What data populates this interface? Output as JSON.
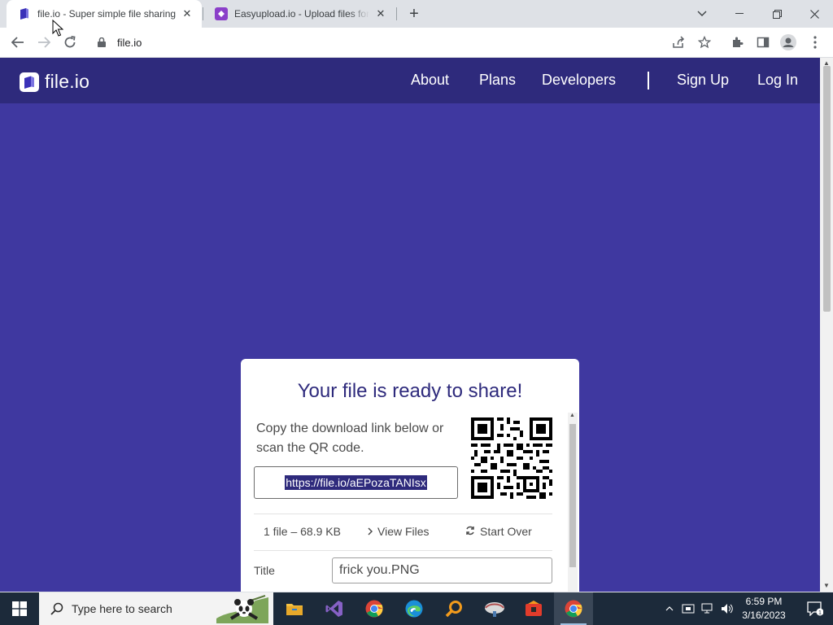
{
  "browser": {
    "tabs": [
      {
        "title": "file.io - Super simple file sharing",
        "favicon": "fileio-favicon",
        "active": true
      },
      {
        "title": "Easyupload.io - Upload files for free",
        "favicon": "easyupload-favicon",
        "active": false
      }
    ],
    "address": "file.io",
    "icons": [
      "back-icon",
      "forward-icon",
      "reload-icon",
      "lock-icon",
      "share-icon",
      "star-icon",
      "extensions-icon",
      "sidepanel-icon",
      "profile-icon",
      "menu-icon"
    ]
  },
  "site": {
    "brand": "file.io",
    "nav": {
      "about": "About",
      "plans": "Plans",
      "developers": "Developers",
      "signup": "Sign Up",
      "login": "Log In"
    }
  },
  "card": {
    "heading": "Your file is ready to share!",
    "description": "Copy the download link below or scan the QR code.",
    "link": "https://file.io/aEPozaTANIsx",
    "file_summary": "1 file – 68.9 KB",
    "view_files": "View Files",
    "start_over": "Start Over",
    "title_label": "Title",
    "title_value": "frick you.PNG"
  },
  "taskbar": {
    "search_placeholder": "Type here to search",
    "apps": [
      "file-explorer-icon",
      "visual-studio-icon",
      "chrome-icon",
      "edge-icon",
      "search-app-icon",
      "app-icon",
      "app-icon-2",
      "chrome-active-icon"
    ],
    "time": "6:59 PM",
    "date": "3/16/2023",
    "notification_count": "1"
  },
  "colors": {
    "page_bg": "#3f38a0",
    "nav_bg": "#2e2a7c",
    "heading": "#2e2a7c",
    "taskbar": "#1c2a3a"
  }
}
